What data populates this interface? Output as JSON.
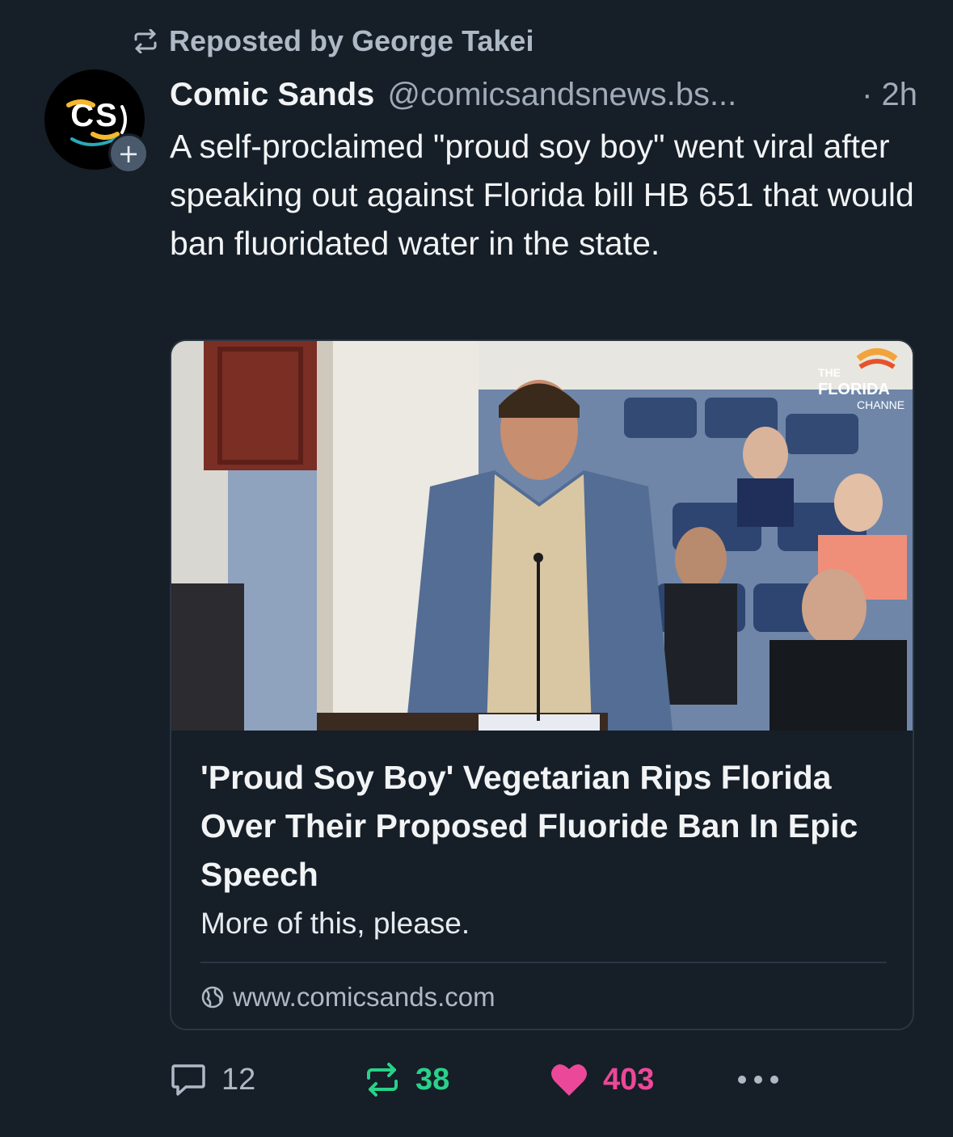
{
  "repost": {
    "label": "Reposted by George Takei",
    "icon": "repost-icon"
  },
  "author": {
    "avatar_text": "CS",
    "name": "Comic Sands",
    "handle": "@comicsandsnews.bs...",
    "time": "· 2h",
    "follow_icon": "plus-icon"
  },
  "post": {
    "text": "A self-proclaimed \"proud soy boy\" went viral after speaking out against Florida bill HB 651 that would ban fluoridated water in the state."
  },
  "embed": {
    "thumbnail_watermark": {
      "line1": "THE",
      "line2": "FLORIDA",
      "line3": "CHANNE"
    },
    "title": "'Proud Soy Boy' Vegetarian Rips Florida Over Their Proposed Fluoride Ban In Epic Speech",
    "description": "More of this, please.",
    "domain": "www.comicsands.com",
    "domain_icon": "globe-icon"
  },
  "actions": {
    "reply": {
      "count": "12",
      "icon": "reply-icon"
    },
    "repost": {
      "count": "38",
      "icon": "repost-icon"
    },
    "like": {
      "count": "403",
      "icon": "heart-icon"
    },
    "more": {
      "icon": "more-icon"
    }
  },
  "colors": {
    "background": "#161e27",
    "muted_text": "#9fabb8",
    "repost_active": "#29d189",
    "like_active": "#ec4899",
    "card_border": "#2b3643"
  }
}
